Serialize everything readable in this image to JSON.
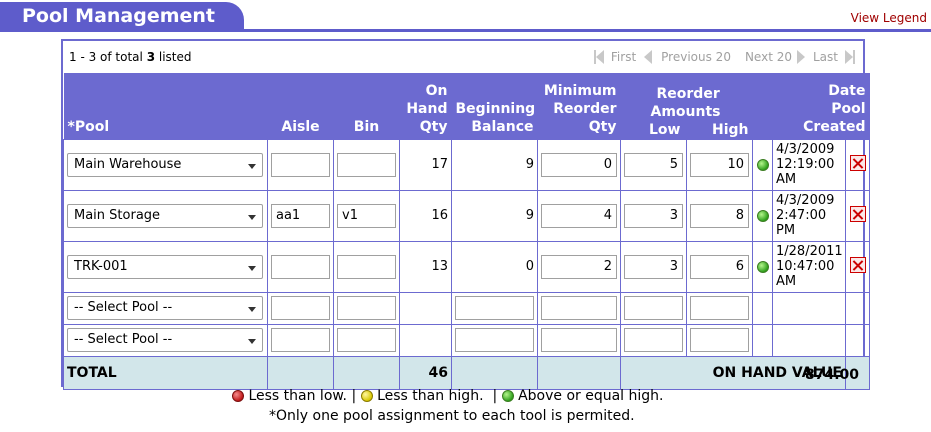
{
  "header": {
    "title": "Pool Management",
    "view_legend": "View Legend"
  },
  "pager": {
    "listed_prefix": "1 - 3 of total ",
    "listed_total": "3",
    "listed_suffix": " listed",
    "first": "First",
    "previous": "Previous 20",
    "next": "Next 20",
    "last": "Last"
  },
  "columns": {
    "pool": "*Pool",
    "aisle": "Aisle",
    "bin": "Bin",
    "on_hand_qty": [
      "On",
      "Hand",
      "Qty"
    ],
    "beginning_balance": [
      "Beginning",
      "Balance"
    ],
    "min_reorder_qty": [
      "Minimum",
      "Reorder",
      "Qty"
    ],
    "reorder_amounts": [
      "Reorder",
      "Amounts"
    ],
    "low": "Low",
    "high": "High",
    "date_pool_created": [
      "Date",
      "Pool",
      "Created"
    ]
  },
  "rows": [
    {
      "pool": "Main Warehouse",
      "aisle": "",
      "bin": "",
      "on_hand": "17",
      "beginning": "9",
      "min_reorder": "0",
      "low": "5",
      "high": "10",
      "status": "green",
      "date": [
        "4/3/2009",
        "12:19:00",
        "AM"
      ]
    },
    {
      "pool": "Main Storage",
      "aisle": "aa1",
      "bin": "v1",
      "on_hand": "16",
      "beginning": "9",
      "min_reorder": "4",
      "low": "3",
      "high": "8",
      "status": "green",
      "date": [
        "4/3/2009",
        "2:47:00",
        "PM"
      ]
    },
    {
      "pool": "TRK-001",
      "aisle": "",
      "bin": "",
      "on_hand": "13",
      "beginning": "0",
      "min_reorder": "2",
      "low": "3",
      "high": "6",
      "status": "green",
      "date": [
        "1/28/2011",
        "10:47:00",
        "AM"
      ]
    }
  ],
  "empty_rows": [
    {
      "pool": "-- Select Pool --"
    },
    {
      "pool": "-- Select Pool --"
    }
  ],
  "total": {
    "label": "TOTAL",
    "on_hand": "46",
    "value_label": "ON HAND VALUE",
    "value": "874.00"
  },
  "legend": {
    "less_low": "Less than low.",
    "less_high": "Less than high.",
    "above_high": "Above or equal high.",
    "sep": "|",
    "note": "*Only one pool assignment to each tool is permited."
  },
  "colors": {
    "header": "#5e5ccb",
    "table_header": "#6c6ad0",
    "total_bg": "#d2e6ea",
    "link": "#a00000"
  }
}
